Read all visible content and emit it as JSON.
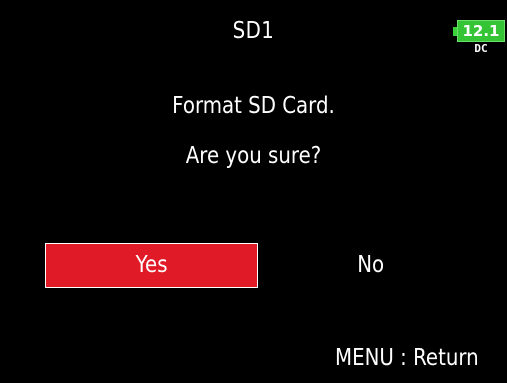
{
  "header": {
    "title": "SD1",
    "battery": {
      "voltage": "12.1",
      "source": "DC",
      "color": "#35c435"
    }
  },
  "dialog": {
    "line1": "Format SD Card.",
    "line2": "Are you sure?",
    "yes_label": "Yes",
    "no_label": "No",
    "selected": "Yes",
    "accent": "#e11a27"
  },
  "footer": {
    "hint": "MENU : Return"
  }
}
